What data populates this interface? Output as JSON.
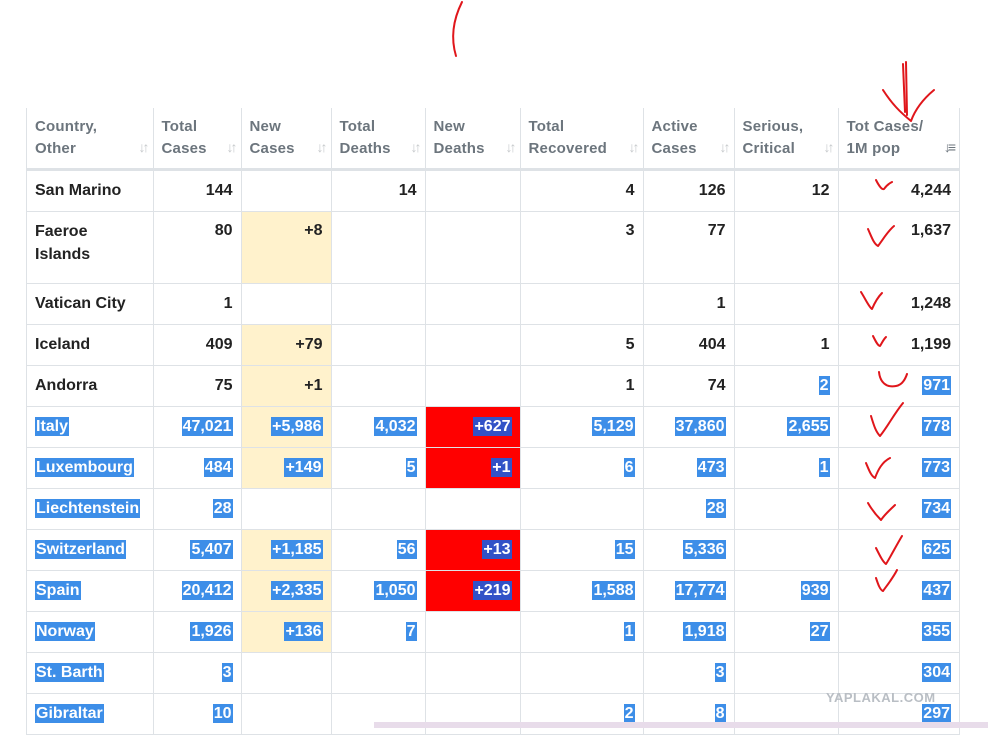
{
  "columns": [
    {
      "l1": "Country,",
      "l2": "Other"
    },
    {
      "l1": "Total",
      "l2": "Cases"
    },
    {
      "l1": "New",
      "l2": "Cases"
    },
    {
      "l1": "Total",
      "l2": "Deaths"
    },
    {
      "l1": "New",
      "l2": "Deaths"
    },
    {
      "l1": "Total",
      "l2": "Recovered"
    },
    {
      "l1": "Active",
      "l2": "Cases"
    },
    {
      "l1": "Serious,",
      "l2": "Critical"
    },
    {
      "l1": "Tot Cases/",
      "l2": "1M pop"
    }
  ],
  "rows": [
    {
      "country": "San Marino",
      "total_cases": "144",
      "new_cases": "",
      "total_deaths": "14",
      "new_deaths": "",
      "total_recovered": "4",
      "active_cases": "126",
      "serious": "12",
      "per_million": "4,244"
    },
    {
      "country": "Faeroe Islands",
      "total_cases": "80",
      "new_cases": "+8",
      "total_deaths": "",
      "new_deaths": "",
      "total_recovered": "3",
      "active_cases": "77",
      "serious": "",
      "per_million": "1,637"
    },
    {
      "country": "Vatican City",
      "total_cases": "1",
      "new_cases": "",
      "total_deaths": "",
      "new_deaths": "",
      "total_recovered": "",
      "active_cases": "1",
      "serious": "",
      "per_million": "1,248"
    },
    {
      "country": "Iceland",
      "total_cases": "409",
      "new_cases": "+79",
      "total_deaths": "",
      "new_deaths": "",
      "total_recovered": "5",
      "active_cases": "404",
      "serious": "1",
      "per_million": "1,199"
    },
    {
      "country": "Andorra",
      "total_cases": "75",
      "new_cases": "+1",
      "total_deaths": "",
      "new_deaths": "",
      "total_recovered": "1",
      "active_cases": "74",
      "serious": "2",
      "per_million": "971"
    },
    {
      "country": "Italy",
      "total_cases": "47,021",
      "new_cases": "+5,986",
      "total_deaths": "4,032",
      "new_deaths": "+627",
      "total_recovered": "5,129",
      "active_cases": "37,860",
      "serious": "2,655",
      "per_million": "778"
    },
    {
      "country": "Luxembourg",
      "total_cases": "484",
      "new_cases": "+149",
      "total_deaths": "5",
      "new_deaths": "+1",
      "total_recovered": "6",
      "active_cases": "473",
      "serious": "1",
      "per_million": "773"
    },
    {
      "country": "Liechtenstein",
      "total_cases": "28",
      "new_cases": "",
      "total_deaths": "",
      "new_deaths": "",
      "total_recovered": "",
      "active_cases": "28",
      "serious": "",
      "per_million": "734"
    },
    {
      "country": "Switzerland",
      "total_cases": "5,407",
      "new_cases": "+1,185",
      "total_deaths": "56",
      "new_deaths": "+13",
      "total_recovered": "15",
      "active_cases": "5,336",
      "serious": "",
      "per_million": "625"
    },
    {
      "country": "Spain",
      "total_cases": "20,412",
      "new_cases": "+2,335",
      "total_deaths": "1,050",
      "new_deaths": "+219",
      "total_recovered": "1,588",
      "active_cases": "17,774",
      "serious": "939",
      "per_million": "437"
    },
    {
      "country": "Norway",
      "total_cases": "1,926",
      "new_cases": "+136",
      "total_deaths": "7",
      "new_deaths": "",
      "total_recovered": "1",
      "active_cases": "1,918",
      "serious": "27",
      "per_million": "355"
    },
    {
      "country": "St. Barth",
      "total_cases": "3",
      "new_cases": "",
      "total_deaths": "",
      "new_deaths": "",
      "total_recovered": "",
      "active_cases": "3",
      "serious": "",
      "per_million": "304"
    },
    {
      "country": "Gibraltar",
      "total_cases": "10",
      "new_cases": "",
      "total_deaths": "",
      "new_deaths": "",
      "total_recovered": "2",
      "active_cases": "8",
      "serious": "",
      "per_million": "297"
    }
  ],
  "selection": {
    "first_selected_row": 5,
    "partial_row": 4,
    "partial_cols": [
      "serious",
      "per_million"
    ]
  },
  "colors": {
    "new_cases_bg": "#fff2cc",
    "new_deaths_bg": "#ff0000",
    "selection": "#3d8ee8",
    "selection_on_red": "#3252c7",
    "annotation_red": "#e0161b"
  },
  "icons": [
    "sort-icon",
    "sort-desc-icon"
  ],
  "watermark": "YAPLAKAL.COM"
}
